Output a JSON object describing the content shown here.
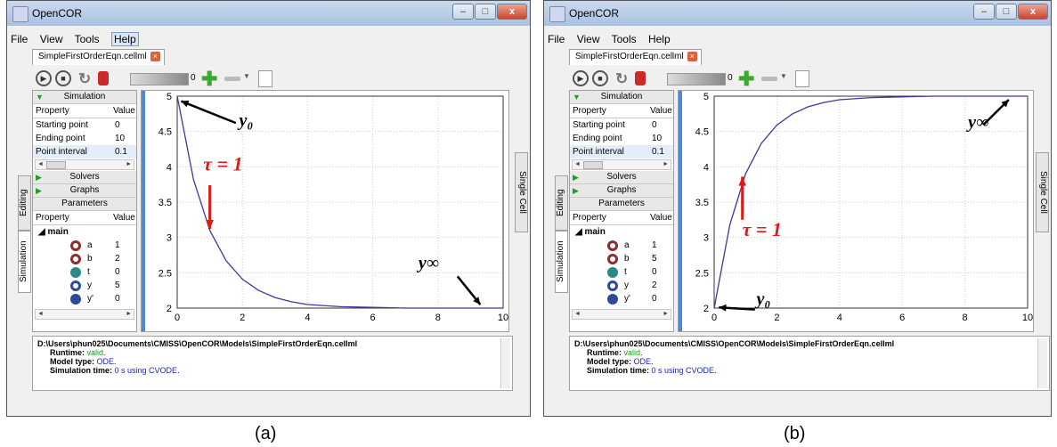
{
  "windows": [
    {
      "caption": "(a)",
      "app_title": "OpenCOR",
      "menu": [
        "File",
        "View",
        "Tools",
        "Help"
      ],
      "file_tab": "SimpleFirstOrderEqn.cellml",
      "toolbar": {
        "counter": "0"
      },
      "side_tabs": {
        "editing": "Editing",
        "simulation": "Simulation",
        "single_cell": "Single Cell"
      },
      "simulation_section": {
        "title": "Simulation",
        "headers": [
          "Property",
          "Value"
        ],
        "rows": [
          {
            "property": "Starting point",
            "value": "0"
          },
          {
            "property": "Ending point",
            "value": "10"
          },
          {
            "property": "Point interval",
            "value": "0.1"
          }
        ]
      },
      "sections": [
        "Solvers",
        "Graphs",
        "Parameters"
      ],
      "parameters": {
        "headers": [
          "Property",
          "Value"
        ],
        "component": "main",
        "rows": [
          {
            "name": "a",
            "value": "1",
            "icon": "state-ring-icon",
            "color": "#8b2e2e",
            "filled": false
          },
          {
            "name": "b",
            "value": "2",
            "icon": "state-ring-icon",
            "color": "#8b2e2e",
            "filled": false
          },
          {
            "name": "t",
            "value": "0",
            "icon": "voi-icon",
            "color": "#2a8a8a",
            "filled": true
          },
          {
            "name": "y",
            "value": "5",
            "icon": "state-ring-icon",
            "color": "#2d4a9a",
            "filled": false
          },
          {
            "name": "y'",
            "value": "0",
            "icon": "rate-icon",
            "color": "#2d4a9a",
            "filled": true
          }
        ]
      },
      "log": {
        "path": "D:\\Users\\phun025\\Documents\\CMISS\\OpenCOR\\Models\\SimpleFirstOrderEqn.cellml",
        "runtime_label": "Runtime:",
        "runtime_value": "valid",
        "model_type_label": "Model type:",
        "model_type_value": "ODE",
        "sim_time_label": "Simulation time:",
        "sim_time_value": "0 s using CVODE"
      },
      "annotations": {
        "y0": "y₀",
        "yinf": "y∞",
        "tau": "τ = 1"
      },
      "chart_data": {
        "type": "line",
        "title": "",
        "xlabel": "",
        "ylabel": "",
        "xlim": [
          0,
          10
        ],
        "ylim": [
          2,
          5
        ],
        "xticks": [
          0,
          2,
          4,
          6,
          8,
          10
        ],
        "yticks": [
          2,
          2.5,
          3,
          3.5,
          4,
          4.5,
          5
        ],
        "ytick_labels": [
          "2",
          "2.5",
          "3",
          "3.5",
          "4",
          "4.5",
          "5"
        ],
        "grid": true,
        "series": [
          {
            "color": "#3a3a9a",
            "x": [
              0,
              0.5,
              1,
              1.5,
              2,
              2.5,
              3,
              3.5,
              4,
              5,
              6,
              7,
              8,
              9,
              10
            ],
            "y": [
              5,
              3.82,
              3.1,
              2.67,
              2.41,
              2.25,
              2.15,
              2.09,
              2.05,
              2.02,
              2.01,
              2.0,
              2.0,
              2.0,
              2.0
            ]
          }
        ]
      }
    },
    {
      "caption": "(b)",
      "app_title": "OpenCOR",
      "menu": [
        "File",
        "View",
        "Tools",
        "Help"
      ],
      "file_tab": "SimpleFirstOrderEqn.cellml",
      "toolbar": {
        "counter": "0"
      },
      "side_tabs": {
        "editing": "Editing",
        "simulation": "Simulation",
        "single_cell": "Single Cell"
      },
      "simulation_section": {
        "title": "Simulation",
        "headers": [
          "Property",
          "Value"
        ],
        "rows": [
          {
            "property": "Starting point",
            "value": "0"
          },
          {
            "property": "Ending point",
            "value": "10"
          },
          {
            "property": "Point interval",
            "value": "0.1"
          }
        ]
      },
      "sections": [
        "Solvers",
        "Graphs",
        "Parameters"
      ],
      "parameters": {
        "headers": [
          "Property",
          "Value"
        ],
        "component": "main",
        "rows": [
          {
            "name": "a",
            "value": "1",
            "icon": "state-ring-icon",
            "color": "#8b2e2e",
            "filled": false
          },
          {
            "name": "b",
            "value": "5",
            "icon": "state-ring-icon",
            "color": "#8b2e2e",
            "filled": false
          },
          {
            "name": "t",
            "value": "0",
            "icon": "voi-icon",
            "color": "#2a8a8a",
            "filled": true
          },
          {
            "name": "y",
            "value": "2",
            "icon": "state-ring-icon",
            "color": "#2d4a9a",
            "filled": false
          },
          {
            "name": "y'",
            "value": "0",
            "icon": "rate-icon",
            "color": "#2d4a9a",
            "filled": true
          }
        ]
      },
      "log": {
        "path": "D:\\Users\\phun025\\Documents\\CMISS\\OpenCOR\\Models\\SimpleFirstOrderEqn.cellml",
        "runtime_label": "Runtime:",
        "runtime_value": "valid",
        "model_type_label": "Model type:",
        "model_type_value": "ODE",
        "sim_time_label": "Simulation time:",
        "sim_time_value": "0 s using CVODE"
      },
      "annotations": {
        "y0": "y₀",
        "yinf": "y∞",
        "tau": "τ = 1"
      },
      "chart_data": {
        "type": "line",
        "title": "",
        "xlabel": "",
        "ylabel": "",
        "xlim": [
          0,
          10
        ],
        "ylim": [
          2,
          5
        ],
        "xticks": [
          0,
          2,
          4,
          6,
          8,
          10
        ],
        "yticks": [
          2,
          2.5,
          3,
          3.5,
          4,
          4.5,
          5
        ],
        "ytick_labels": [
          "2",
          "2.5",
          "3",
          "3.5",
          "4",
          "4.5",
          "5"
        ],
        "grid": true,
        "series": [
          {
            "color": "#3a3a9a",
            "x": [
              0,
              0.5,
              1,
              1.5,
              2,
              2.5,
              3,
              3.5,
              4,
              5,
              6,
              7,
              8,
              9,
              10
            ],
            "y": [
              2,
              3.18,
              3.9,
              4.33,
              4.59,
              4.75,
              4.85,
              4.91,
              4.95,
              4.98,
              4.99,
              5.0,
              5.0,
              5.0,
              5.0
            ]
          }
        ]
      }
    }
  ]
}
